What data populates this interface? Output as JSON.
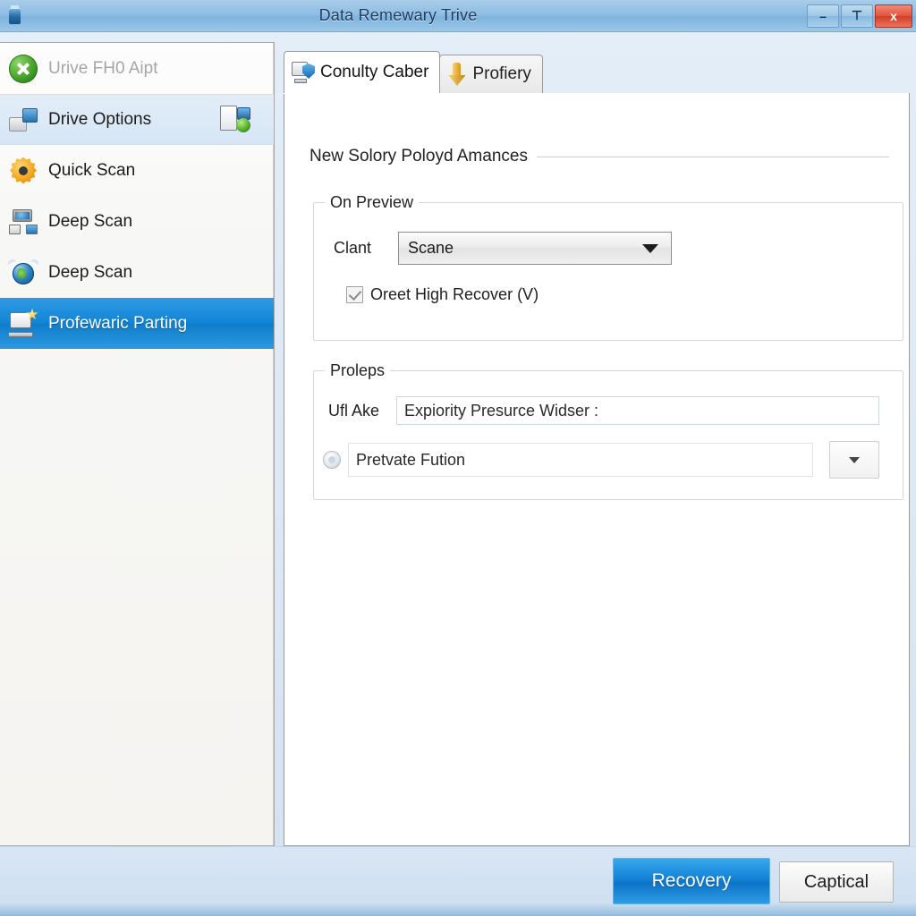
{
  "window": {
    "title": "Data Remewary Trive",
    "app_icon": "drive-icon",
    "controls": {
      "minimize": "–",
      "maximize": "⊤",
      "close": "x"
    }
  },
  "sidebar": {
    "items": [
      {
        "label": "Urive FH0 Aipt",
        "icon": "green-x-circle-icon",
        "state": "disabled",
        "trailing_icon": ""
      },
      {
        "label": "Drive Options",
        "icon": "drive-pair-icon",
        "state": "hover",
        "trailing_icon": "document-network-icon"
      },
      {
        "label": "Quick Scan",
        "icon": "orange-gear-icon",
        "state": "normal",
        "trailing_icon": ""
      },
      {
        "label": "Deep Scan",
        "icon": "network-monitor-icon",
        "state": "normal",
        "trailing_icon": ""
      },
      {
        "label": "Deep Scan",
        "icon": "blue-globe-icon",
        "state": "normal",
        "trailing_icon": ""
      },
      {
        "label": "Profewaric Parting",
        "icon": "monitor-star-icon",
        "state": "selected",
        "trailing_icon": ""
      }
    ]
  },
  "tabs": [
    {
      "label": "Conulty Caber",
      "icon": "monitor-shield-icon",
      "active": true
    },
    {
      "label": "Profiery",
      "icon": "gold-arrow-icon",
      "active": false
    }
  ],
  "content": {
    "section_header": "New Solory Poloyd Amances",
    "groups": [
      {
        "title": "On Preview",
        "combo_label": "Clant",
        "combo_value": "Scane",
        "checkbox_label": "Oreet High Recover (V)",
        "checkbox_checked": true
      },
      {
        "title": "Proleps",
        "field1_label": "Ufl Ake",
        "field1_value": "Expiority Presurce Widser :",
        "field2_value": "Pretvate Fution",
        "field2_icon": "circle-button-icon",
        "dropdown_icon": "chevron-down-icon"
      }
    ]
  },
  "footer": {
    "primary_button": "Recovery",
    "secondary_button": "Captical"
  },
  "colors": {
    "accent": "#1282d6",
    "titlebar": "#8fbde3",
    "close_button": "#d33d26",
    "selected_nav": "#1184d6"
  }
}
